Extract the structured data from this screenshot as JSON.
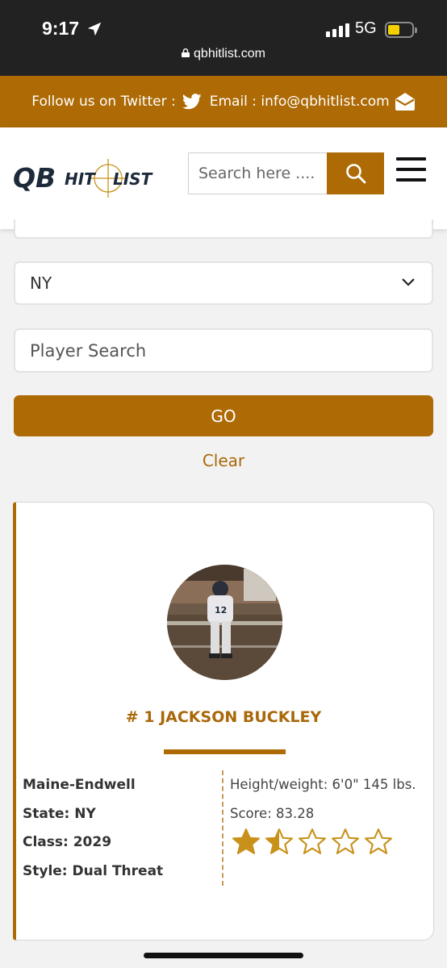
{
  "status_bar": {
    "time": "9:17",
    "network": "5G",
    "url": "qbhitlist.com"
  },
  "topbar": {
    "twitter_label": "Follow us on Twitter :",
    "email_label": "Email : info@qbhitlist.com"
  },
  "header": {
    "logo_text_qb": "QB",
    "logo_text_hit": "HIT",
    "logo_text_list": "LIST",
    "search_placeholder": "Search here ...."
  },
  "filters": {
    "state_selected": "NY",
    "player_search_placeholder": "Player Search",
    "go_label": "GO",
    "clear_label": "Clear"
  },
  "player": {
    "rank_name": "# 1 JACKSON BUCKLEY",
    "school": "Maine-Endwell",
    "state": "State: NY",
    "class": "Class: 2029",
    "style": "Style: Dual Threat",
    "height_weight": "Height/weight: 6'0\" 145 lbs.",
    "score": "Score: 83.28",
    "jersey_number": "12",
    "stars_rating": 1.5,
    "stars_max": 5
  },
  "colors": {
    "brand": "#ad6a05",
    "status_bar": "#222222",
    "star": "#c8911a"
  }
}
